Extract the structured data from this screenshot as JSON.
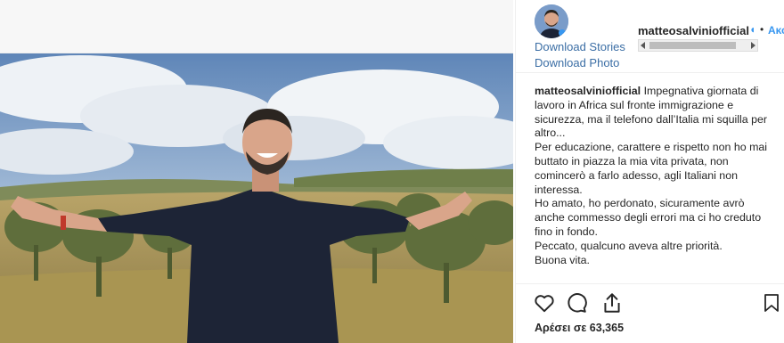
{
  "post": {
    "username": "matteosalviniofficial",
    "verified_icon": "verified-badge-icon",
    "separator": "•",
    "follow_label": "Ακολουθήστε",
    "download_stories": "Download Stories",
    "download_photo": "Download Photo",
    "caption_paragraphs": [
      "Impegnativa giornata di lavoro in Africa sul fronte immigrazione e sicurezza, ma il telefono dall’Italia mi squilla per altro...",
      "Per educazione, carattere e rispetto non ho mai buttato in piazza la mia vita privata, non comincerò a farlo adesso, agli Italiani non interessa.",
      "Ho amato, ho perdonato, sicuramente avrò anche commesso degli errori ma ci ho creduto fino in fondo.",
      "Peccato, qualcuno aveva altre priorità.",
      "Buona vita."
    ],
    "likes_text": "Αρέσει σε 63,365"
  },
  "icons": {
    "like": "heart-icon",
    "comment": "comment-icon",
    "share": "share-icon",
    "save": "bookmark-icon"
  },
  "colors": {
    "link": "#3b6ea5",
    "accent": "#3897f0",
    "text": "#262626",
    "divider": "#efefef"
  }
}
